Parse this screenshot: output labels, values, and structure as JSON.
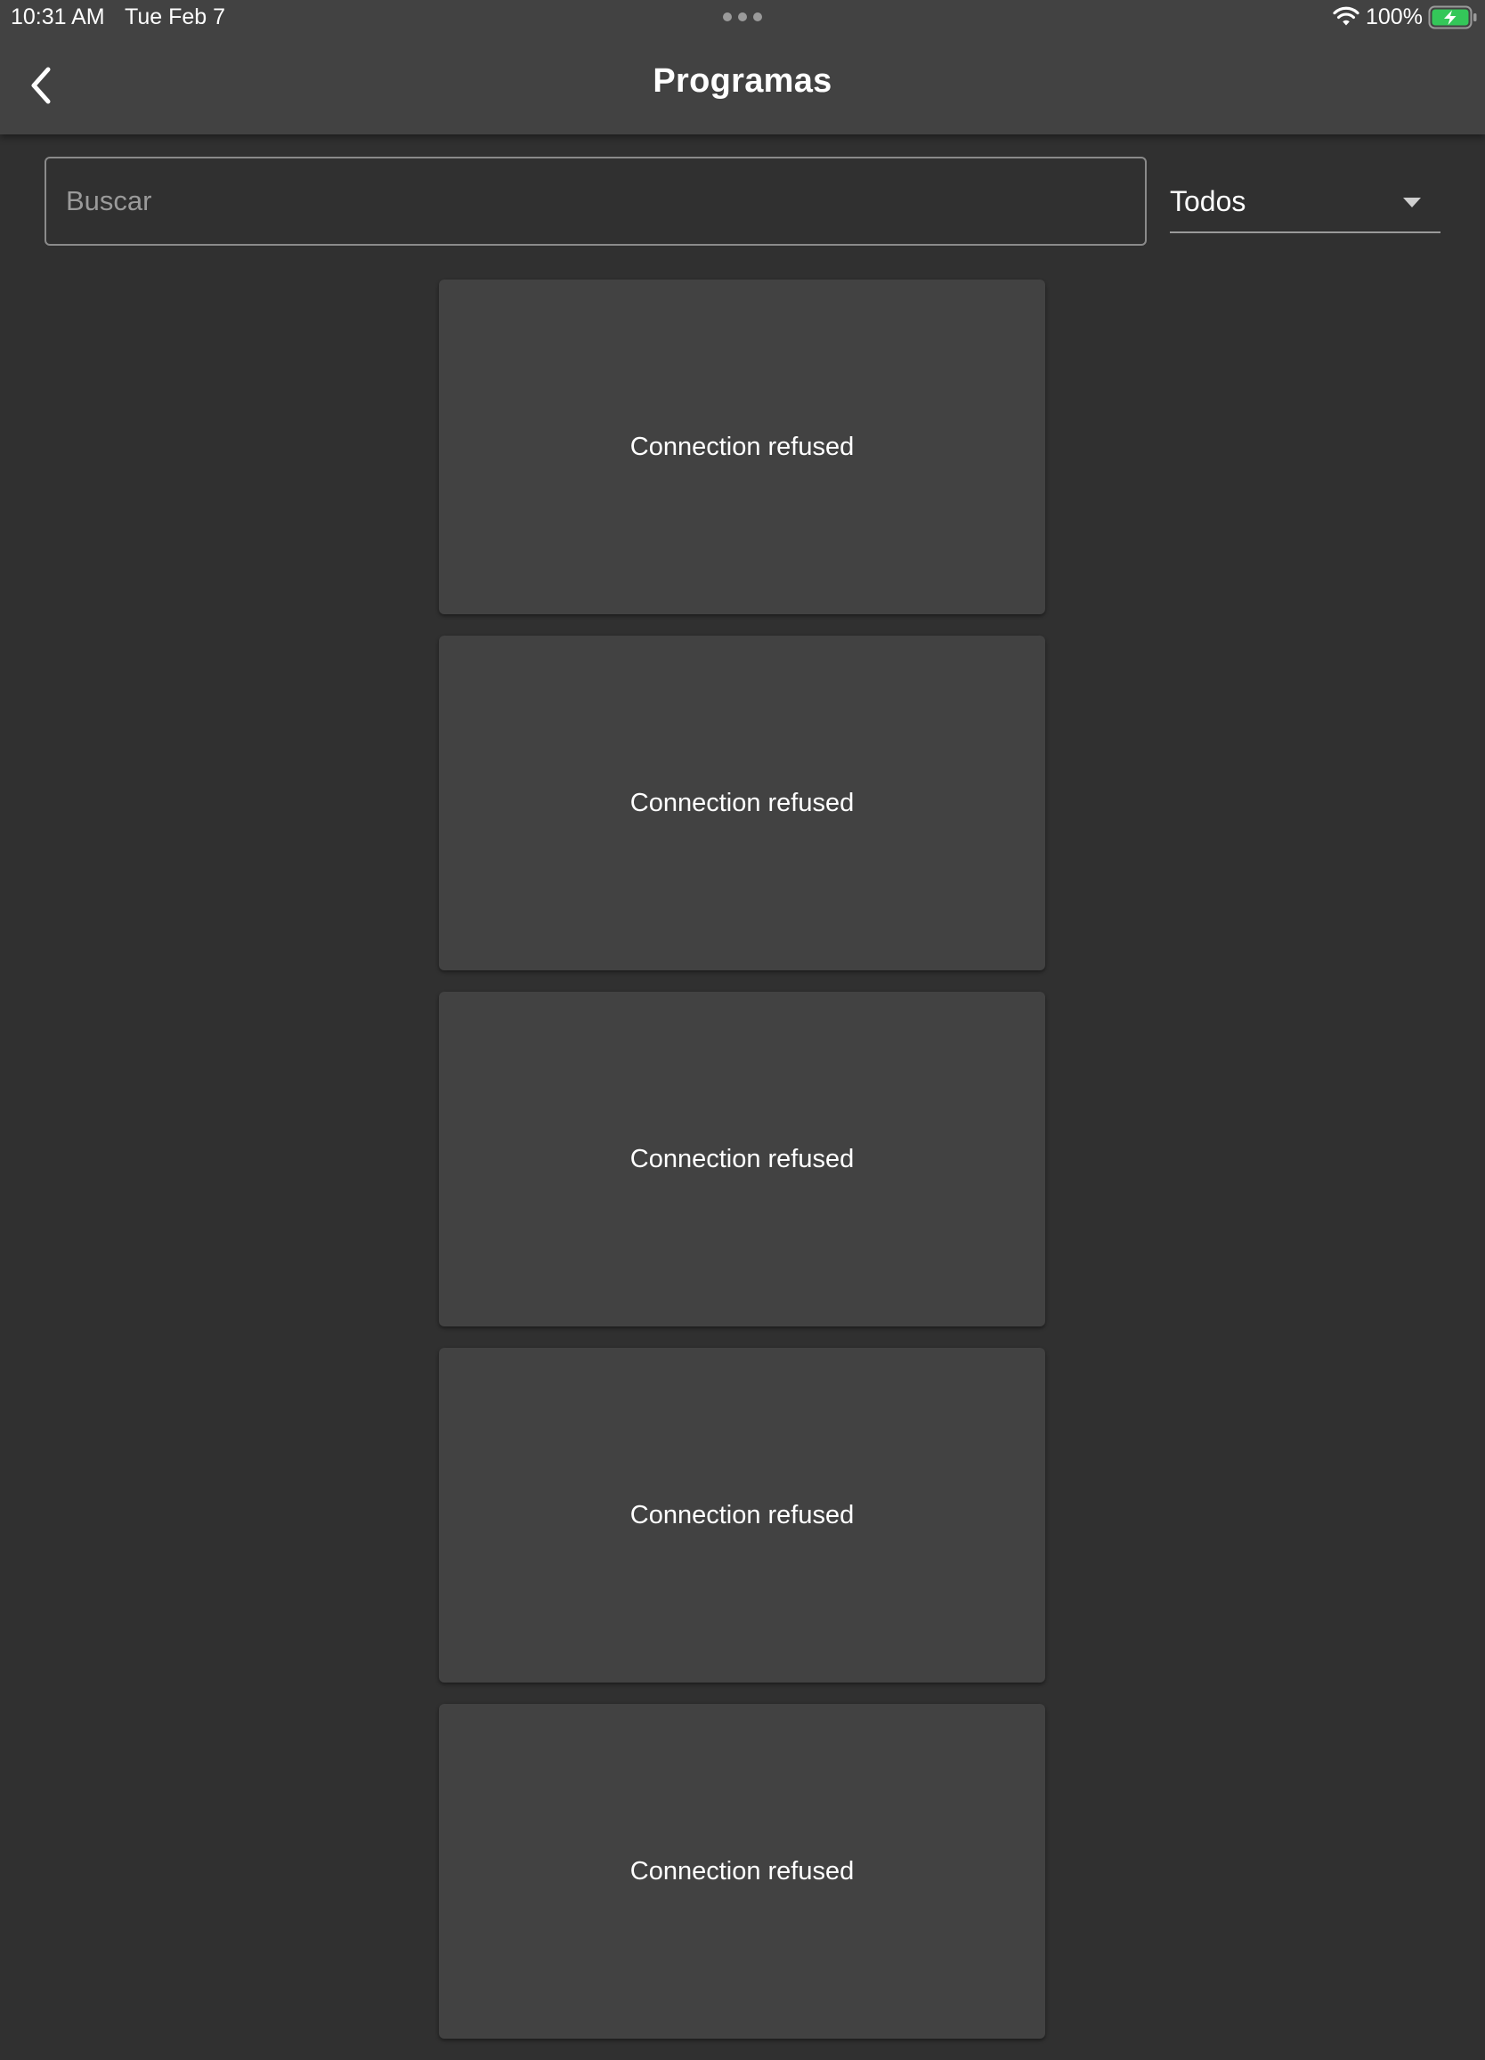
{
  "status_bar": {
    "time": "10:31 AM",
    "date": "Tue Feb 7",
    "battery": "100%"
  },
  "header": {
    "title": "Programas",
    "back_icon": "chevron-left-icon"
  },
  "search": {
    "placeholder": "Buscar",
    "value": ""
  },
  "filter": {
    "selected": "Todos"
  },
  "programs": [
    {
      "message": "Connection refused"
    },
    {
      "message": "Connection refused"
    },
    {
      "message": "Connection refused"
    },
    {
      "message": "Connection refused"
    },
    {
      "message": "Connection refused"
    }
  ],
  "colors": {
    "background": "#303030",
    "appbar": "#424242",
    "card": "#424242",
    "battery_fill": "#34c759"
  }
}
